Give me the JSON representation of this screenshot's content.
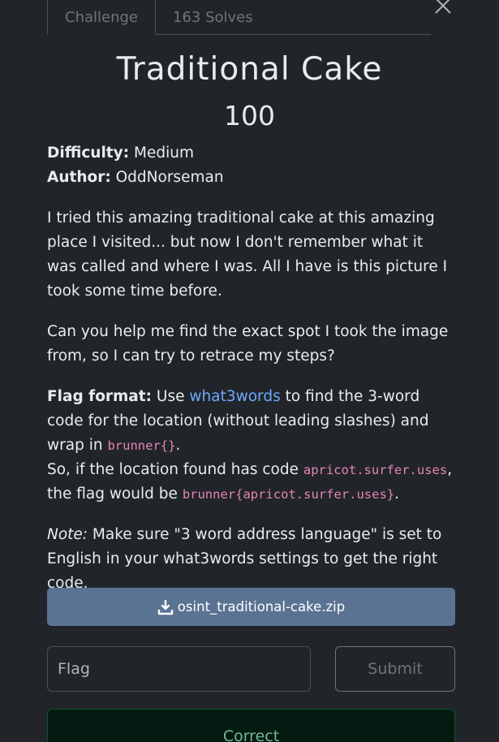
{
  "tabs": [
    {
      "label": "Challenge",
      "active": true
    },
    {
      "label": "163 Solves",
      "active": false
    }
  ],
  "challenge": {
    "title": "Traditional Cake",
    "points": "100",
    "difficulty_label": "Difficulty:",
    "difficulty": "Medium",
    "author_label": "Author:",
    "author": "OddNorseman",
    "paragraph1": "I tried this amazing traditional cake at this amazing place I visited... but now I don't remember what it was called and where I was. All I have is this picture I took some time before.",
    "paragraph2": "Can you help me find the exact spot I took the image from, so I can try to retrace my steps?",
    "flag_format_label": "Flag format:",
    "use_text": "Use",
    "what3words_link": "what3words",
    "find_text": "to find the 3-word code for the location (without leading slashes) and wrap in",
    "wrapper_code": "brunner{}",
    "period": ".",
    "example_prefix": "So, if the location found has code",
    "example_code": "apricot.surfer.uses",
    "example_mid": ", the flag would be",
    "example_flag": "brunner{apricot.surfer.uses}",
    "note_label": "Note:",
    "note_text": "Make sure \"3 word address language\" is set to English in your what3words settings to get the right code."
  },
  "download": {
    "filename": "osint_traditional-cake.zip",
    "icon": "download-icon"
  },
  "flag_form": {
    "placeholder": "Flag",
    "value": "",
    "submit_label": "Submit",
    "status": "Correct"
  },
  "colors": {
    "background": "#212529",
    "link": "#6ea8fe",
    "code": "#e685b5",
    "download_button": "#5a7392",
    "correct_text": "#75b798"
  }
}
